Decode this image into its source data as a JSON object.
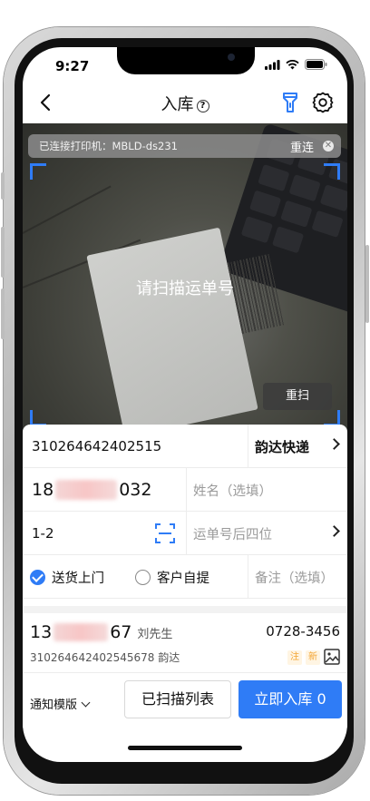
{
  "status_bar": {
    "time": "9:27"
  },
  "nav": {
    "title": "入库"
  },
  "camera": {
    "printer_status": "已连接打印机：MBLD-ds231",
    "reconnect_label": "重连",
    "scan_prompt": "请扫描运单号",
    "rescan_label": "重扫"
  },
  "form": {
    "tracking_number": "310264642402515",
    "courier": "韵达快递",
    "phone_prefix": "18",
    "phone_suffix": "032",
    "name_placeholder": "姓名（选填）",
    "shelf_code": "1-2",
    "last4_placeholder": "运单号后四位",
    "delivery_options": [
      {
        "label": "送货上门",
        "checked": true
      },
      {
        "label": "客户自提",
        "checked": false
      }
    ],
    "note_placeholder": "备注（选填）"
  },
  "record": {
    "phone_prefix": "13",
    "phone_suffix": "67",
    "name": "刘先生",
    "tel": "0728-3456",
    "tracking": "310264642402545678 韵达",
    "tags": [
      "注",
      "新"
    ]
  },
  "bottom": {
    "template_label": "通知模版",
    "scanned_list_label": "已扫描列表",
    "submit_label": "立即入库 0"
  },
  "colors": {
    "accent": "#2f7cf6",
    "tag": "#f3a533"
  }
}
